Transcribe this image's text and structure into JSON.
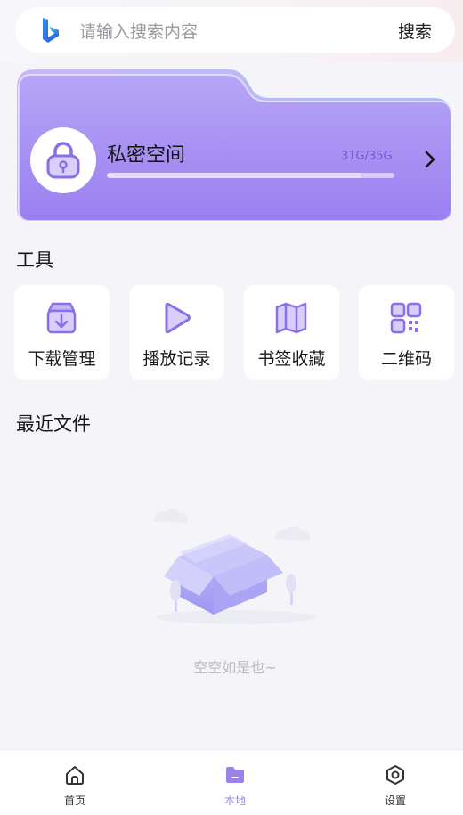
{
  "search": {
    "placeholder": "请输入搜索内容",
    "button_label": "搜索"
  },
  "private_space": {
    "title": "私密空间",
    "usage": "31G/35G",
    "used_fraction": 0.886
  },
  "tools": {
    "title": "工具",
    "items": [
      {
        "label": "下载管理",
        "icon": "download-box-icon"
      },
      {
        "label": "播放记录",
        "icon": "play-icon"
      },
      {
        "label": "书签收藏",
        "icon": "map-bookmark-icon"
      },
      {
        "label": "二维码",
        "icon": "qr-code-icon"
      }
    ]
  },
  "recent": {
    "title": "最近文件",
    "empty_text": "空空如是也~"
  },
  "nav": {
    "items": [
      {
        "label": "首页",
        "icon": "home-icon"
      },
      {
        "label": "本地",
        "icon": "folder-icon",
        "active": true
      },
      {
        "label": "设置",
        "icon": "settings-icon"
      }
    ]
  },
  "colors": {
    "accent": "#9a82ea",
    "card_purple": "#a28bf2"
  }
}
